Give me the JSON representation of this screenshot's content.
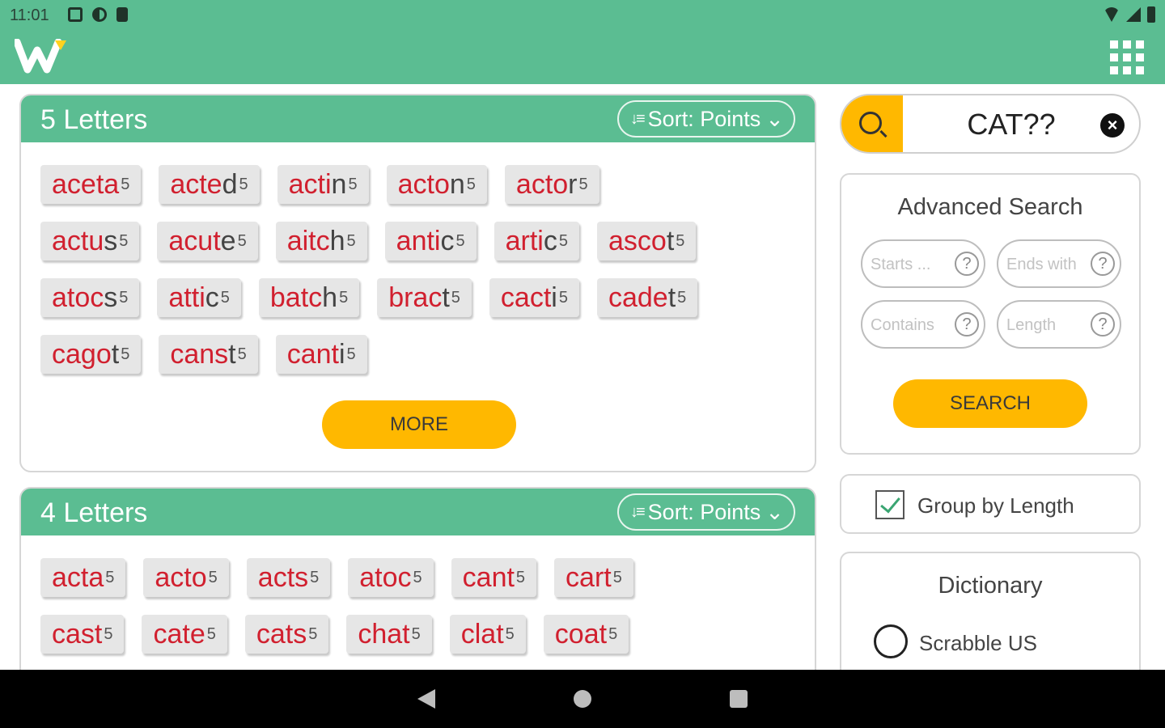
{
  "status_bar": {
    "time": "11:01",
    "icons": [
      "notification-icon",
      "sync-icon",
      "sd-card-icon",
      "wifi-icon",
      "signal-icon",
      "battery-icon"
    ]
  },
  "app_bar": {
    "logo": "W",
    "menu_icon": "apps-grid-icon"
  },
  "colors": {
    "primary_green": "#5bbd92",
    "accent_yellow": "#ffb800",
    "highlight_red": "#d1202f"
  },
  "sections": [
    {
      "title": "5 Letters",
      "sort_label": "Sort: Points",
      "rows": [
        [
          {
            "pre": "",
            "hl": "aceta",
            "post": "",
            "pts": "5"
          },
          {
            "pre": "",
            "hl": "acte",
            "post": "d",
            "pts": "5"
          },
          {
            "pre": "",
            "hl": "acti",
            "post": "n",
            "pts": "5"
          },
          {
            "pre": "",
            "hl": "acto",
            "post": "n",
            "pts": "5"
          },
          {
            "pre": "",
            "hl": "acto",
            "post": "r",
            "pts": "5"
          }
        ],
        [
          {
            "pre": "",
            "hl": "actu",
            "post": "s",
            "pts": "5"
          },
          {
            "pre": "",
            "hl": "acut",
            "post": "e",
            "pts": "5"
          },
          {
            "pre": "",
            "hl": "aitc",
            "post": "h",
            "pts": "5"
          },
          {
            "pre": "",
            "hl": "anti",
            "post": "c",
            "pts": "5"
          },
          {
            "pre": "",
            "hl": "arti",
            "post": "c",
            "pts": "5"
          },
          {
            "pre": "",
            "hl": "asco",
            "post": "t",
            "pts": "5"
          }
        ],
        [
          {
            "pre": "",
            "hl": "atoc",
            "post": "s",
            "pts": "5"
          },
          {
            "pre": "",
            "hl": "atti",
            "post": "c",
            "pts": "5"
          },
          {
            "pre": "",
            "hl": "batc",
            "post": "h",
            "pts": "5"
          },
          {
            "pre": "",
            "hl": "brac",
            "post": "t",
            "pts": "5"
          },
          {
            "pre": "",
            "hl": "cact",
            "post": "i",
            "pts": "5"
          },
          {
            "pre": "",
            "hl": "cade",
            "post": "t",
            "pts": "5"
          }
        ],
        [
          {
            "pre": "",
            "hl": "cago",
            "post": "t",
            "pts": "5"
          },
          {
            "pre": "",
            "hl": "cans",
            "post": "t",
            "pts": "5"
          },
          {
            "pre": "",
            "hl": "cant",
            "post": "i",
            "pts": "5"
          }
        ]
      ],
      "more_label": "MORE"
    },
    {
      "title": "4 Letters",
      "sort_label": "Sort: Points",
      "rows": [
        [
          {
            "pre": "",
            "hl": "acta",
            "post": "",
            "pts": "5"
          },
          {
            "pre": "",
            "hl": "acto",
            "post": "",
            "pts": "5"
          },
          {
            "pre": "",
            "hl": "acts",
            "post": "",
            "pts": "5"
          },
          {
            "pre": "",
            "hl": "atoc",
            "post": "",
            "pts": "5"
          },
          {
            "pre": "",
            "hl": "cant",
            "post": "",
            "pts": "5"
          },
          {
            "pre": "",
            "hl": "cart",
            "post": "",
            "pts": "5"
          }
        ],
        [
          {
            "pre": "",
            "hl": "cast",
            "post": "",
            "pts": "5"
          },
          {
            "pre": "",
            "hl": "cate",
            "post": "",
            "pts": "5"
          },
          {
            "pre": "",
            "hl": "cats",
            "post": "",
            "pts": "5"
          },
          {
            "pre": "",
            "hl": "chat",
            "post": "",
            "pts": "5"
          },
          {
            "pre": "",
            "hl": "clat",
            "post": "",
            "pts": "5"
          },
          {
            "pre": "",
            "hl": "coat",
            "post": "",
            "pts": "5"
          }
        ]
      ]
    }
  ],
  "search": {
    "value": "CAT??"
  },
  "advanced_search": {
    "title": "Advanced Search",
    "starts_placeholder": "Starts ...",
    "ends_placeholder": "Ends with",
    "contains_placeholder": "Contains",
    "length_placeholder": "Length",
    "help_glyph": "?",
    "search_label": "SEARCH"
  },
  "group_by_length": {
    "label": "Group by Length",
    "checked": true
  },
  "dictionary": {
    "title": "Dictionary",
    "option": "Scrabble US",
    "selected": false
  }
}
